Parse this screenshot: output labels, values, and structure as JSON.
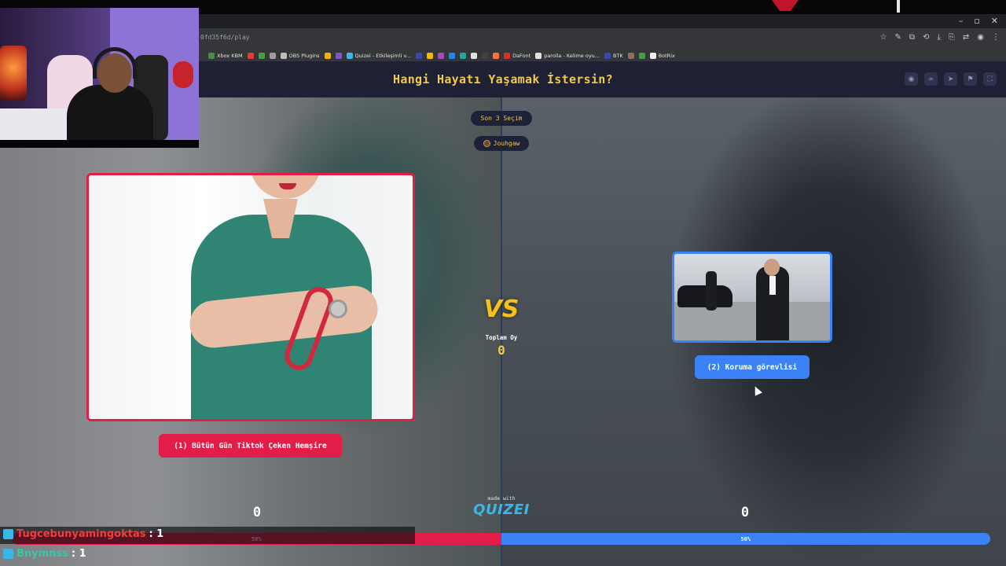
{
  "browser": {
    "url": "0fd35f6d/play",
    "window_controls": [
      "–",
      "▫",
      "✕"
    ],
    "bookmarks": [
      {
        "label": "Xbox KBM",
        "color": "#4a8a4a"
      },
      {
        "label": "",
        "color": "#e53935"
      },
      {
        "label": "",
        "color": "#43a047"
      },
      {
        "label": "",
        "color": "#9e9e9e"
      },
      {
        "label": "OBS Plugins",
        "color": "#bdbdbd"
      },
      {
        "label": "",
        "color": "#f4b400"
      },
      {
        "label": "",
        "color": "#7e57c2"
      },
      {
        "label": "Quizei - Etkileşimli v...",
        "color": "#3ab7e8"
      },
      {
        "label": "",
        "color": "#3949ab"
      },
      {
        "label": "",
        "color": "#f0b90b"
      },
      {
        "label": "",
        "color": "#ab47bc"
      },
      {
        "label": "",
        "color": "#1e88e5"
      },
      {
        "label": "",
        "color": "#26a69a"
      },
      {
        "label": "",
        "color": "#e0e0e0"
      },
      {
        "label": "",
        "color": "#424242"
      },
      {
        "label": "",
        "color": "#ff7043"
      },
      {
        "label": "DaFont",
        "color": "#d32f2f"
      },
      {
        "label": "parolla - Kelime oyu...",
        "color": "#e0e0e0"
      },
      {
        "label": "BTK",
        "color": "#3949ab"
      },
      {
        "label": "",
        "color": "#8d6e63"
      },
      {
        "label": "",
        "color": "#43a047"
      },
      {
        "label": "BotRix",
        "color": "#eeeeee"
      }
    ]
  },
  "app": {
    "title": "Hangi Hayatı Yaşamak İstersin?",
    "header_icons": [
      "eye-icon",
      "link-icon",
      "send-icon",
      "flag-icon",
      "fullscreen-icon"
    ],
    "recent_label": "Son 3 Seçim",
    "recent_user": "Jouhgaw",
    "left_option": "(1) Bütün Gün Tiktok Çeken Hemşire",
    "right_option": "(2) Koruma görevlisi",
    "vs_label": "VS",
    "total_label": "Toplam Oy",
    "total_value": "0",
    "left_count": "0",
    "right_count": "0",
    "made_with": "made with",
    "brand": "QUIZEI",
    "left_percent": "50%",
    "right_percent": "50%",
    "left_share": 50,
    "right_share": 50,
    "colors": {
      "left": "#e11d48",
      "right": "#3b82f6",
      "title": "#f2c94c"
    }
  },
  "chat": [
    {
      "name": "Tugcebunyamingoktas",
      "count": ": 1"
    },
    {
      "name": "Bnymnss",
      "count": ": 1"
    }
  ]
}
